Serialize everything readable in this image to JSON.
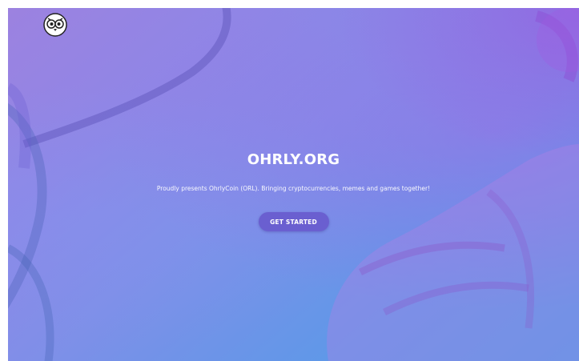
{
  "hero": {
    "title": "OHRLY.ORG",
    "subtitle": "Proudly presents OhrlyCoin (ORL). Bringing cryptocurrencies, memes and games together!",
    "cta_label": "GET STARTED"
  },
  "colors": {
    "gradient_start": "#9c82e0",
    "gradient_end": "#4c9de6",
    "button_bg": "#6a5fd0",
    "text": "#ffffff"
  },
  "icons": {
    "logo": "owl-logo-icon"
  }
}
